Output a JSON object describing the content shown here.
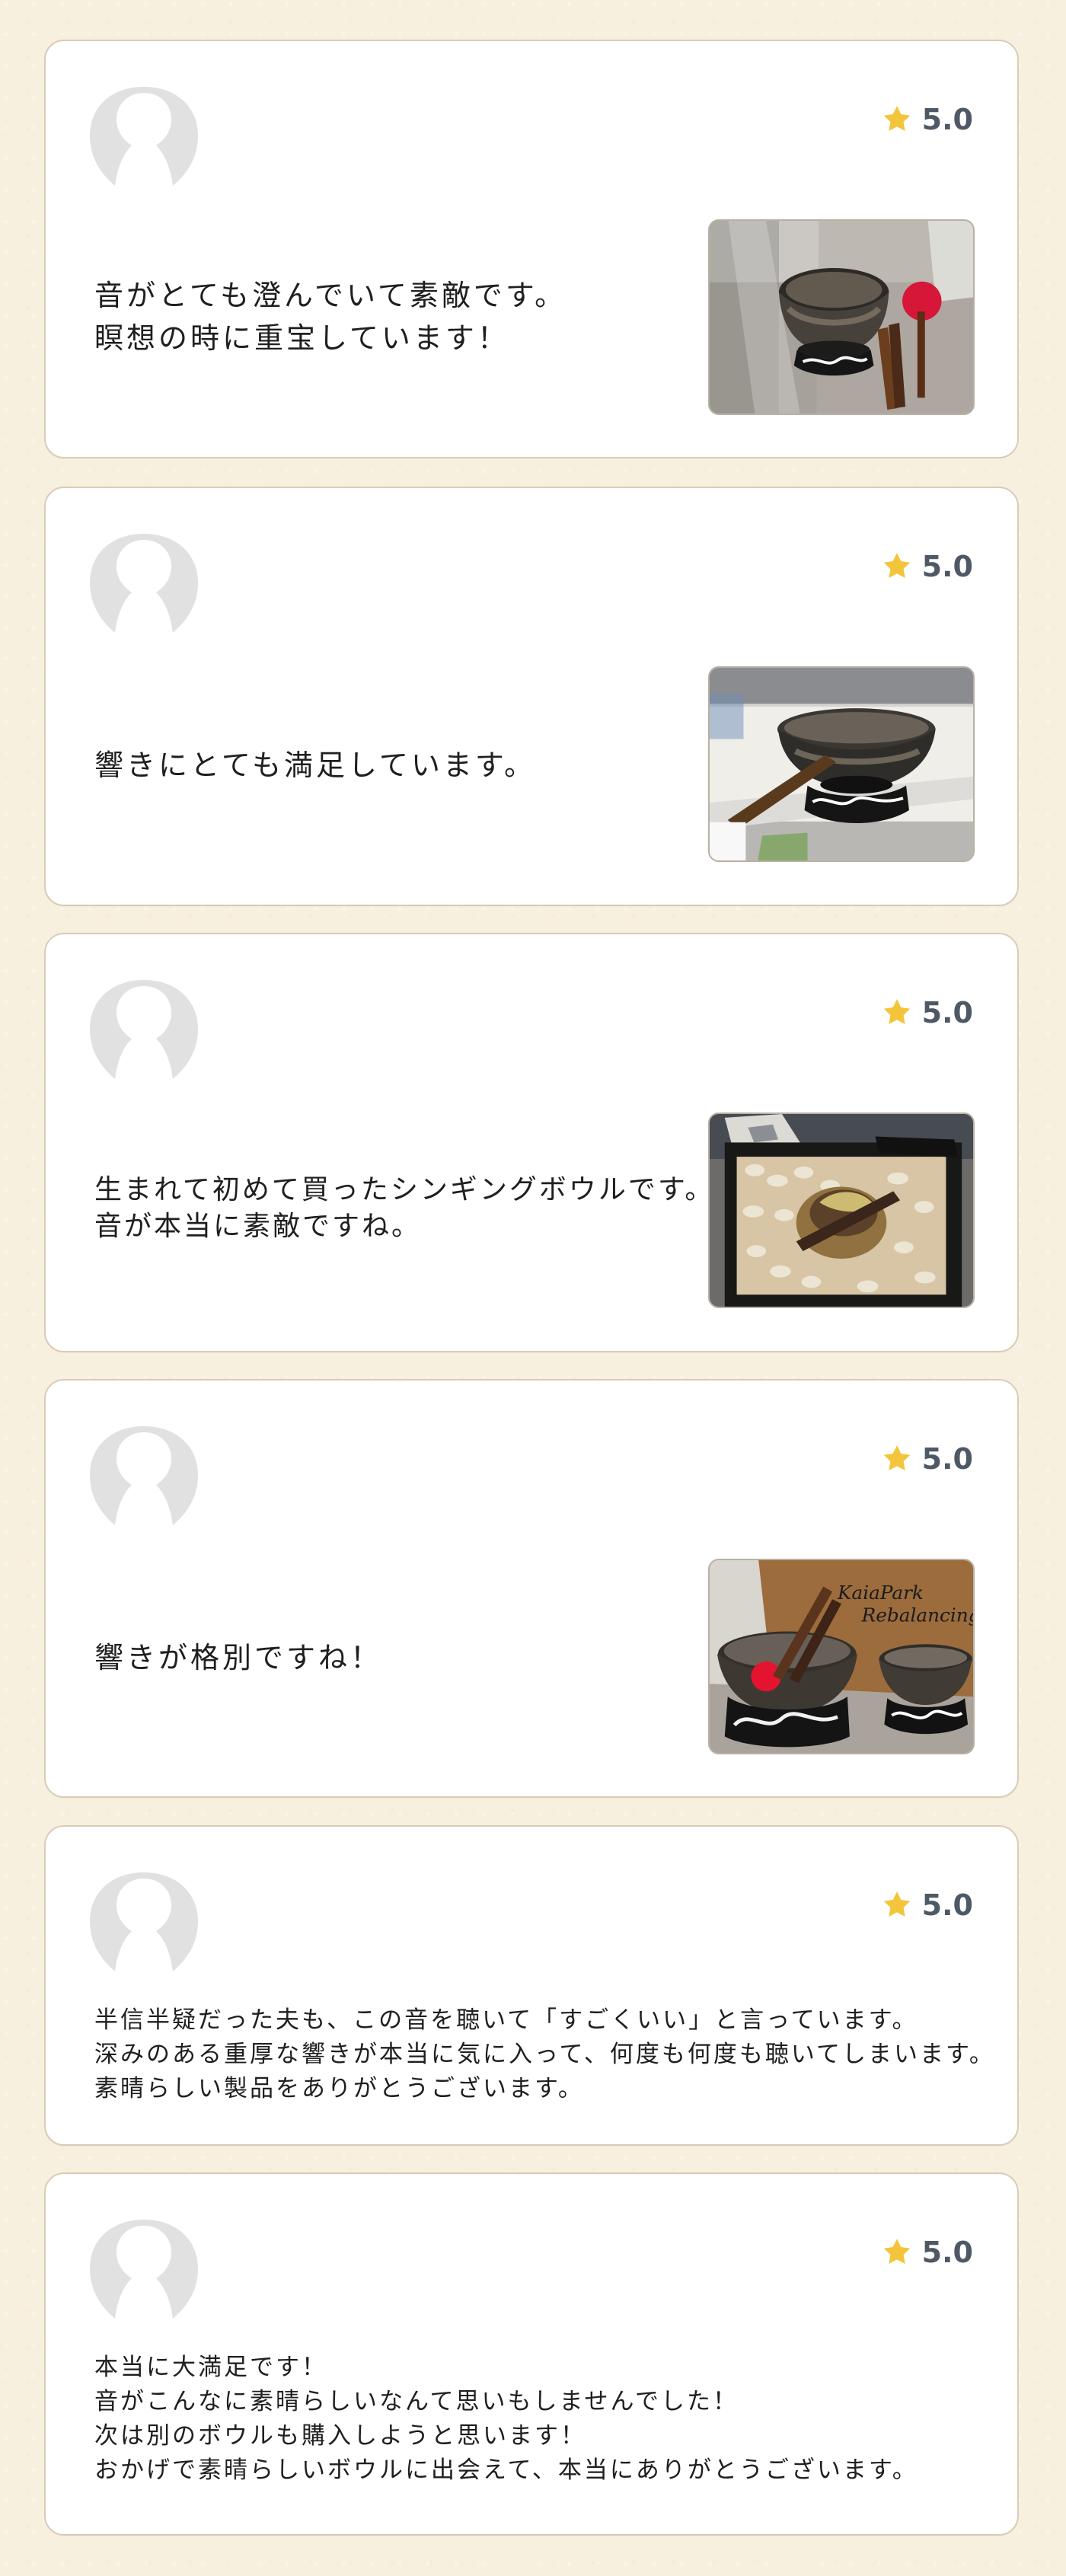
{
  "reviews": [
    {
      "rating": "5.0",
      "text": "音がとても澄んでいて素敵です。\n瞑想の時に重宝しています！",
      "photo": "singing-bowl-photo-1"
    },
    {
      "rating": "5.0",
      "text": "響きにとても満足しています。",
      "photo": "singing-bowl-photo-2"
    },
    {
      "rating": "5.0",
      "text": "生まれて初めて買ったシンギングボウルです。\n音が本当に素敵ですね。",
      "photo": "singing-bowl-photo-3"
    },
    {
      "rating": "5.0",
      "text": "響きが格別ですね！",
      "photo": "singing-bowl-photo-4",
      "photo_text": "KaiaPark\nRebalancing"
    },
    {
      "rating": "5.0",
      "text": "半信半疑だった夫も、この音を聴いて「すごくいい」と言っています。\n深みのある重厚な響きが本当に気に入って、何度も何度も聴いてしまいます。\n素晴らしい製品をありがとうございます。"
    },
    {
      "rating": "5.0",
      "text": "本当に大満足です！\n音がこんなに素晴らしいなんて思いもしませんでした！\n次は別のボウルも購入しようと思います！\nおかげで素晴らしいボウルに出会えて、本当にありがとうございます。"
    }
  ],
  "colors": {
    "page_background": "#f8f0df",
    "card_border": "#d9ccb7",
    "star": "#f3c53b",
    "rating_text": "#4f5966"
  },
  "icons": {
    "avatar": "user-placeholder-icon",
    "rating": "star-icon"
  }
}
